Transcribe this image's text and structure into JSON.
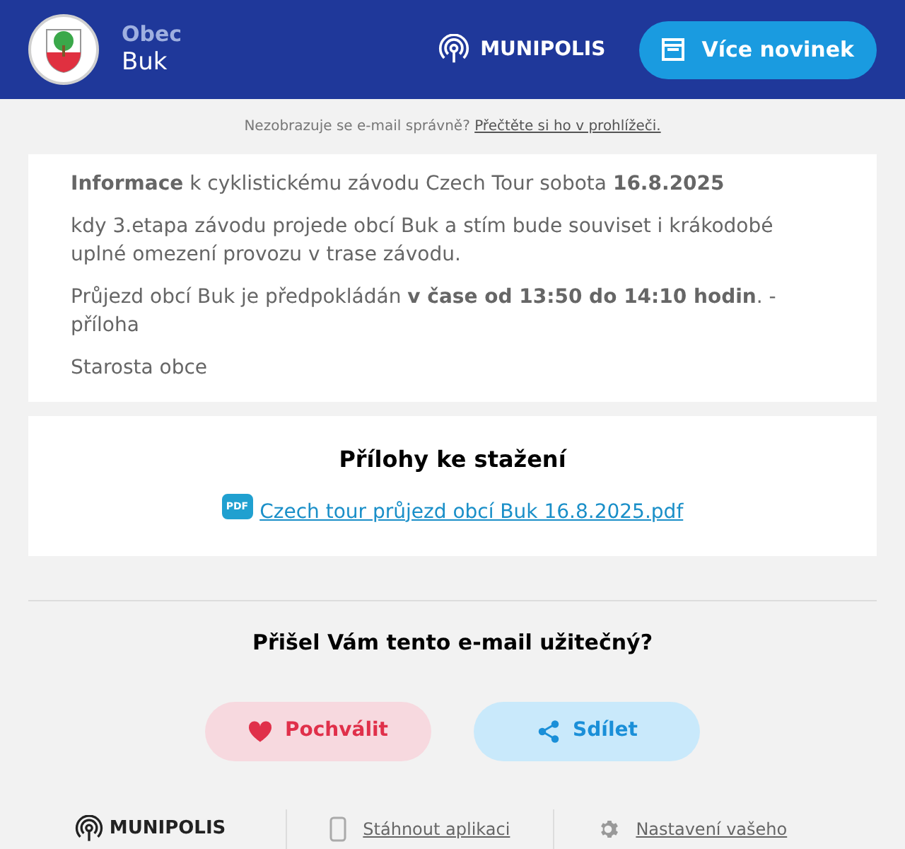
{
  "header": {
    "kicker": "Obec",
    "name": "Buk",
    "brand": "MUNIPOLIS",
    "button": "Více novinek"
  },
  "preheader": {
    "text": "Nezobrazuje se e-mail správně?",
    "link": "Přečtěte si ho v prohlížeči."
  },
  "article": {
    "paragraphs": [
      "**Informace** k cyklistickému závodu Czech Tour sobota **16.8.2025**",
      "kdy 3.etapa závodu projede obcí Buk a stím bude souviset i krákodobé uplné omezení provozu v trase závodu.",
      "Průjezd obcí Buk je předpokládán **v čase od 13:50 do 14:10 hodin**. - příloha",
      "Starosta obce"
    ]
  },
  "attachments": {
    "title": "Přílohy ke stažení",
    "files": [
      {
        "icon": "PDF",
        "name": "Czech tour průjezd obcí Buk 16.8.2025.pdf"
      }
    ]
  },
  "feedback": {
    "question": "Přišel Vám tento e-mail užitečný?",
    "buttons": [
      {
        "kind": "like",
        "label": "Pochválit"
      },
      {
        "kind": "share",
        "label": "Sdílet"
      }
    ]
  },
  "footer": {
    "brand": "MUNIPOLIS",
    "links": [
      {
        "kind": "app",
        "label": "Stáhnout aplikaci"
      },
      {
        "kind": "settings",
        "label": "Nastavení vašeho"
      }
    ]
  }
}
